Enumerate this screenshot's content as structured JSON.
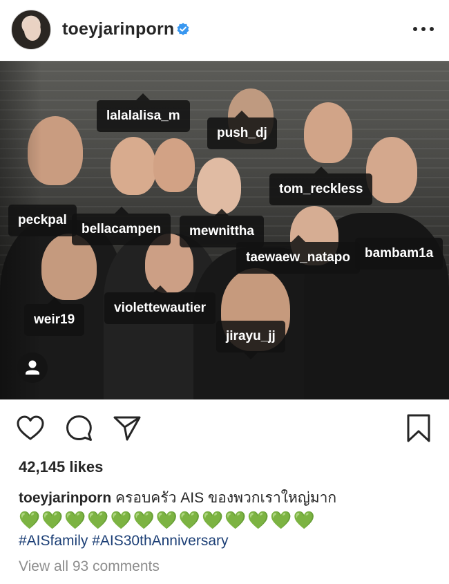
{
  "post": {
    "username": "toeyjarinporn",
    "verified": true,
    "likes": "42,145 likes",
    "caption_user": "toeyjarinporn",
    "caption_text": "ครอบครัว AIS ของพวกเราใหญ่มาก",
    "caption_emojis": "💚💚💚💚💚💚💚💚💚💚💚💚💚",
    "hashtag_1": "#AISfamily",
    "hashtag_2": "#AIS30thAnniversary",
    "view_comments": "View all 93 comments"
  },
  "tags": {
    "t1": "lalalalisa_m",
    "t2": "push_dj",
    "t3": "tom_reckless",
    "t4": "peckpal",
    "t5": "bellacampen",
    "t6": "mewnittha",
    "t7": "taewaew_natapo",
    "t8": "bambam1a",
    "t9": "violettewautier",
    "t10": "weir19",
    "t11": "jirayu_jj"
  },
  "icons": {
    "verified": "verified-badge-icon",
    "more": "more-options-icon",
    "like": "heart-icon",
    "comment": "comment-icon",
    "share": "paper-plane-icon",
    "save": "bookmark-icon",
    "user_tags": "person-icon"
  },
  "colors": {
    "verified": "#3897f0",
    "hashtag": "#1c3f76",
    "muted": "#8e8e8e",
    "heart_emoji": "#4cae3b"
  }
}
